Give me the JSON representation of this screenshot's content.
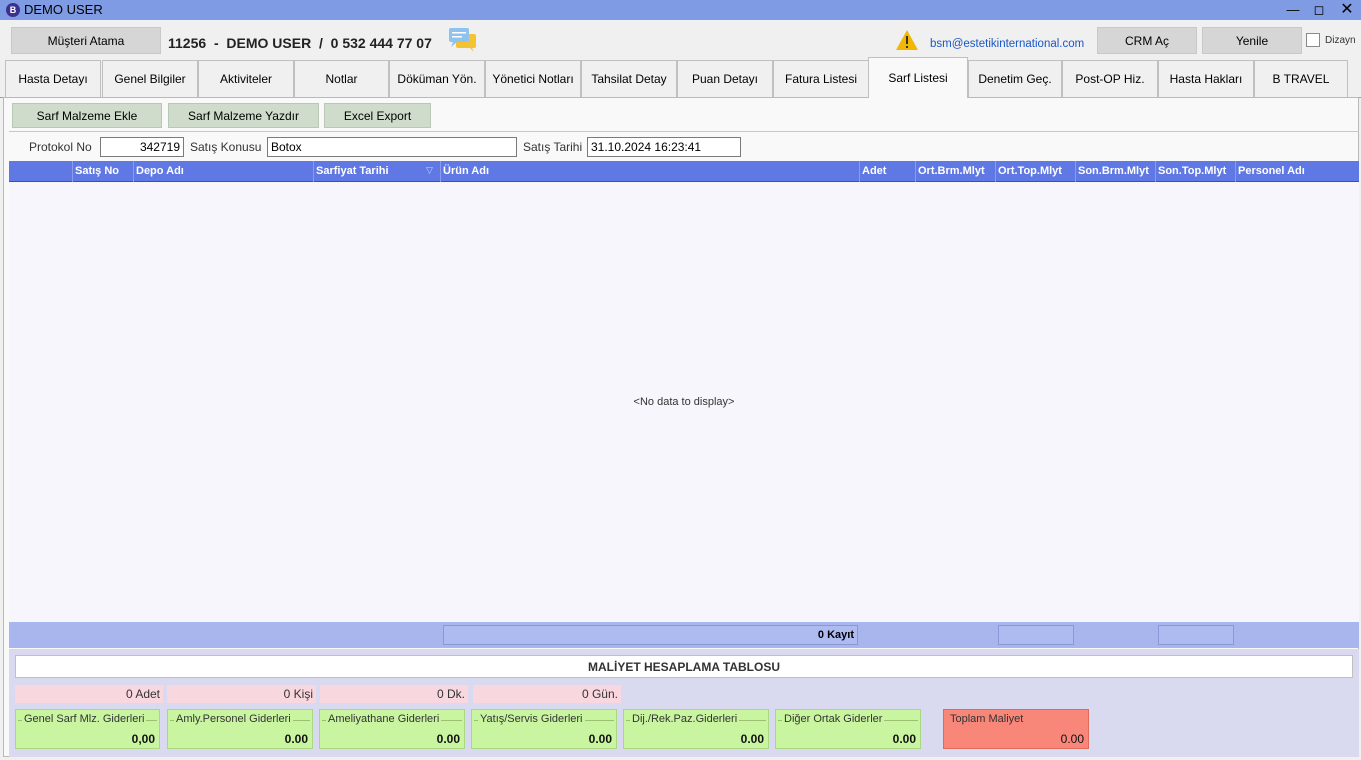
{
  "window": {
    "title": "DEMO USER",
    "app_icon_letter": "B"
  },
  "header": {
    "assign_button": "Müşteri Atama",
    "customer_id": "11256",
    "customer_name": "DEMO USER",
    "phone": "0 532 444 77 07",
    "email": "bsm@estetikinternational.com",
    "crm_button": "CRM Aç",
    "refresh_button": "Yenile",
    "design_label": "Dizayn"
  },
  "tabs": [
    {
      "label": "Hasta Detayı"
    },
    {
      "label": "Genel Bilgiler"
    },
    {
      "label": "Aktiviteler"
    },
    {
      "label": "Notlar"
    },
    {
      "label": "Döküman Yön."
    },
    {
      "label": "Yönetici Notları"
    },
    {
      "label": "Tahsilat Detay"
    },
    {
      "label": "Puan Detayı"
    },
    {
      "label": "Fatura Listesi"
    },
    {
      "label": "Sarf Listesi",
      "active": true
    },
    {
      "label": "Denetim Geç."
    },
    {
      "label": "Post-OP Hiz."
    },
    {
      "label": "Hasta Hakları"
    },
    {
      "label": "B TRAVEL"
    }
  ],
  "toolbar": {
    "add_button": "Sarf Malzeme Ekle",
    "print_button": "Sarf Malzeme Yazdır",
    "export_button": "Excel Export"
  },
  "form": {
    "protocol_label": "Protokol No",
    "protocol_value": "342719",
    "subject_label": "Satış Konusu",
    "subject_value": "Botox",
    "date_label": "Satış Tarihi",
    "date_value": "31.10.2024 16:23:41"
  },
  "grid": {
    "columns": [
      "",
      "Satış No",
      "Depo Adı",
      "Sarfiyat Tarihi",
      "Ürün Adı",
      "Adet",
      "Ort.Brm.Mlyt",
      "Ort.Top.Mlyt",
      "Son.Brm.Mlyt",
      "Son.Top.Mlyt",
      "Personel Adı"
    ],
    "empty_text": "<No data to display>",
    "record_count": "0 Kayıt"
  },
  "cost": {
    "title": "MALİYET HESAPLAMA TABLOSU",
    "stats": [
      "0 Adet",
      "0 Kişi",
      "0 Dk.",
      "0 Gün."
    ],
    "items": [
      {
        "label": "Genel Sarf Mlz. Giderleri",
        "value": "0,00"
      },
      {
        "label": "Amly.Personel Giderleri",
        "value": "0.00"
      },
      {
        "label": "Ameliyathane Giderleri",
        "value": "0.00"
      },
      {
        "label": "Yatış/Servis Giderleri",
        "value": "0.00"
      },
      {
        "label": "Dij./Rek.Paz.Giderleri",
        "value": "0.00"
      },
      {
        "label": "Diğer Ortak Giderler",
        "value": "0.00"
      }
    ],
    "total": {
      "label": "Toplam Maliyet",
      "value": "0.00"
    }
  },
  "colors": {
    "titlebar": "#7f9be3",
    "grid_header": "#5f78e3",
    "cost_green": "#c9f5a0",
    "total_red": "#f8877a"
  }
}
